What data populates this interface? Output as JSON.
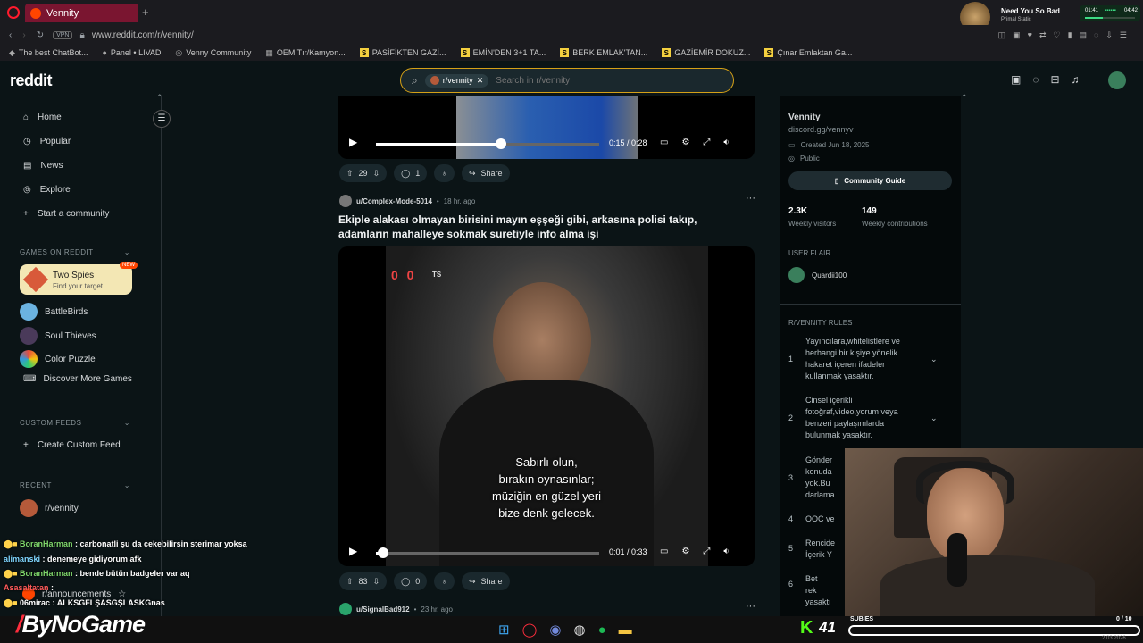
{
  "browser": {
    "tab_title": "Vennity",
    "url": "www.reddit.com/r/vennity/",
    "vpn": "VPN",
    "bookmarks": [
      "The best ChatBot...",
      "Panel • LIVAD",
      "Venny Community",
      "OEM Tır/Kamyon...",
      "PASİFİKTEN GAZİ...",
      "EMİN'DEN 3+1 TA...",
      "BERK EMLAK'TAN...",
      "GAZİEMİR DOKUZ...",
      "Çınar Emlaktan Ga..."
    ],
    "music": {
      "title": "Need You So Bad",
      "artist": "Primal Static",
      "elapsed": "01:41",
      "total": "04:42"
    }
  },
  "reddit": {
    "logo": "reddit",
    "search_chip": "r/vennity",
    "search_placeholder": "Search in r/vennity"
  },
  "sidebar": {
    "nav": [
      "Home",
      "Popular",
      "News",
      "Explore",
      "Start a community"
    ],
    "games_title": "GAMES ON REDDIT",
    "games": [
      {
        "name": "Two Spies",
        "sub": "Find your target",
        "badge": "NEW"
      },
      {
        "name": "BattleBirds"
      },
      {
        "name": "Soul Thieves"
      },
      {
        "name": "Color Puzzle"
      },
      {
        "name": "Discover More Games"
      }
    ],
    "custom_title": "CUSTOM FEEDS",
    "create_feed": "Create Custom Feed",
    "recent_title": "RECENT",
    "recent": [
      "r/vennity",
      "r/announcements"
    ]
  },
  "feed": {
    "post1": {
      "time": "0:15 / 0:28",
      "progress": 0.56,
      "votes": "29",
      "comments": "1",
      "share": "Share"
    },
    "post2": {
      "author": "u/Complex-Mode-5014",
      "age": "18 hr. ago",
      "title": "Ekiple alakası olmayan birisini mayın eşşeği gibi, arkasına polisi takıp, adamların mahalleye sokmak suretiyle info alma işi",
      "score": "0 0",
      "score_tag": "TS",
      "subtitle": [
        "Sabırlı olun,",
        "bırakın oynasınlar;",
        "müziğin en güzel yeri",
        "bize denk gelecek."
      ],
      "time": "0:01 / 0:33",
      "progress": 0.03,
      "votes": "83",
      "comments": "0",
      "share": "Share"
    },
    "post3": {
      "author": "u/SignalBad912",
      "age": "23 hr. ago"
    }
  },
  "right": {
    "name": "Vennity",
    "link": "discord.gg/vennyv",
    "created": "Created Jun 18, 2025",
    "visibility": "Public",
    "guide": "Community Guide",
    "stats": [
      {
        "v": "2.3K",
        "l": "Weekly visitors"
      },
      {
        "v": "149",
        "l": "Weekly contributions"
      }
    ],
    "flair_title": "USER FLAIR",
    "flair_user": "Quardii100",
    "rules_title": "R/VENNITY RULES",
    "rules": [
      {
        "n": "1",
        "t": "Yayıncılara,whitelistlere ve herhangi bir kişiye yönelik hakaret içeren ifadeler kullanmak yasaktır."
      },
      {
        "n": "2",
        "t": "Cinsel içerikli fotoğraf,video,yorum veya benzeri paylaşımlarda bulunmak yasaktır."
      },
      {
        "n": "3",
        "t": "Gönder konuda yok.Bu darlama"
      },
      {
        "n": "4",
        "t": "OOC ve"
      },
      {
        "n": "5",
        "t": "Rencide İçerik Y"
      },
      {
        "n": "6",
        "t": "Bet rek yasaktı"
      }
    ]
  },
  "overlay": {
    "chat": [
      {
        "user": "BoranHarman",
        "msg": " : carbonatli şu da cekebilirsin sterimar yoksa"
      },
      {
        "user": "alimanski",
        "msg": " : denemeye gidiyorum afk"
      },
      {
        "user": "BoranHarman",
        "msg": " : bende bütün badgeler var aq"
      },
      {
        "user": "Asasaltatan",
        "msg": " : "
      },
      {
        "user": "06mirac",
        "msg": " : ALKSGFLŞASGŞLASKGnas"
      }
    ],
    "brand": "ByNoGame",
    "k_count": "41",
    "subies": "SUBIES",
    "sub_progress": "0 / 10",
    "date": "2.03.2026"
  }
}
